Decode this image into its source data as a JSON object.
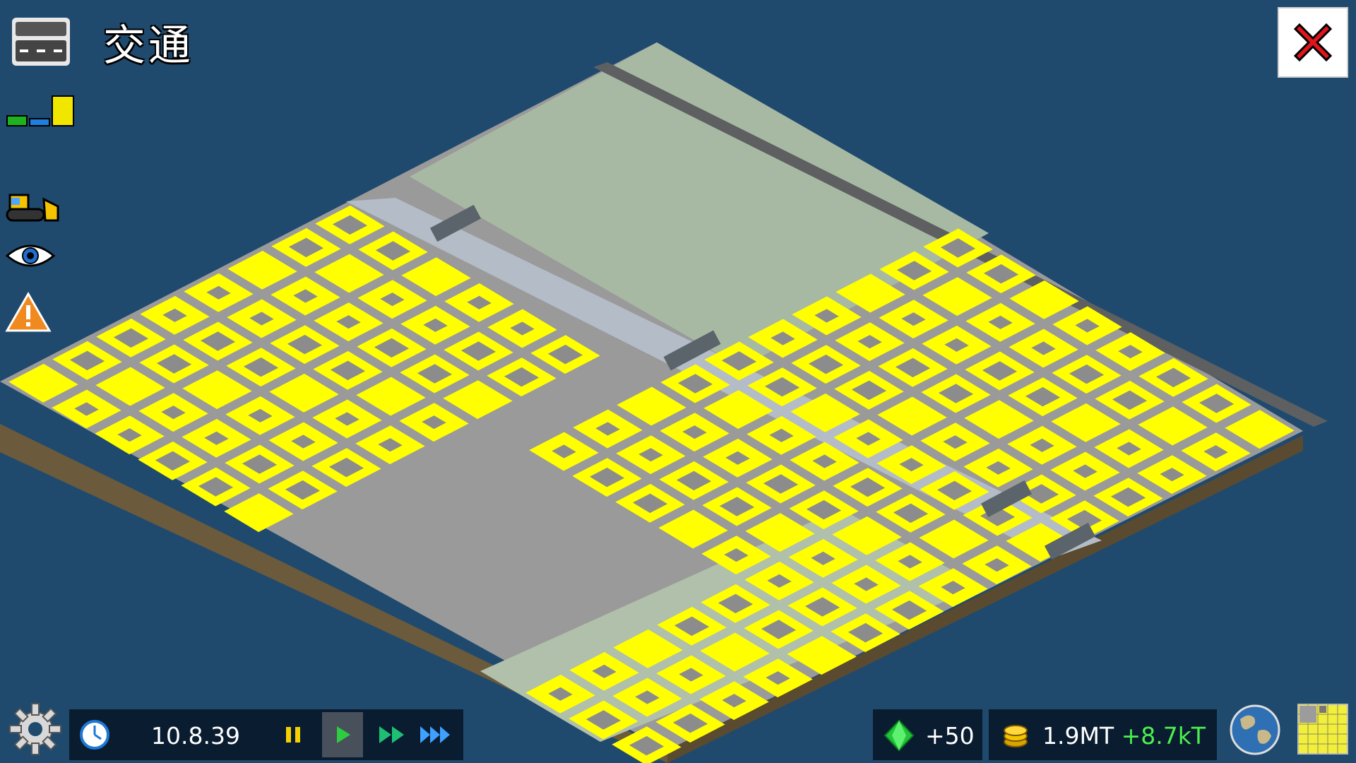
{
  "overlay": {
    "title": "交通",
    "icon": "road-icon"
  },
  "sidebar": {
    "tools": [
      {
        "icon": "traffic-level-bars-icon"
      },
      {
        "icon": "bulldozer-icon"
      },
      {
        "icon": "eye-icon"
      },
      {
        "icon": "warning-icon"
      }
    ]
  },
  "close": {
    "icon": "close-icon",
    "color": "#e0141c"
  },
  "bottom": {
    "date": "10.8.39",
    "speed_controls": [
      {
        "icon": "pause-icon",
        "active": false
      },
      {
        "icon": "play-icon",
        "active": true
      },
      {
        "icon": "fast-forward-icon",
        "active": false
      },
      {
        "icon": "fastest-forward-icon",
        "active": false
      }
    ],
    "diamonds": {
      "value": "+50",
      "icon": "diamond-icon"
    },
    "money": {
      "value": "1.9MT",
      "delta": "+8.7kT",
      "icon": "coins-icon"
    },
    "settings_icon": "gear-icon",
    "world_icon": "globe-icon",
    "minimap_icon": "minimap-icon"
  },
  "colors": {
    "water": "#1f4a6e",
    "zone": "#ffff00",
    "building": "#8c8c8c",
    "road": "#bdbdbd",
    "grass": "#a5b7a0",
    "accent_green": "#4cf04c"
  }
}
